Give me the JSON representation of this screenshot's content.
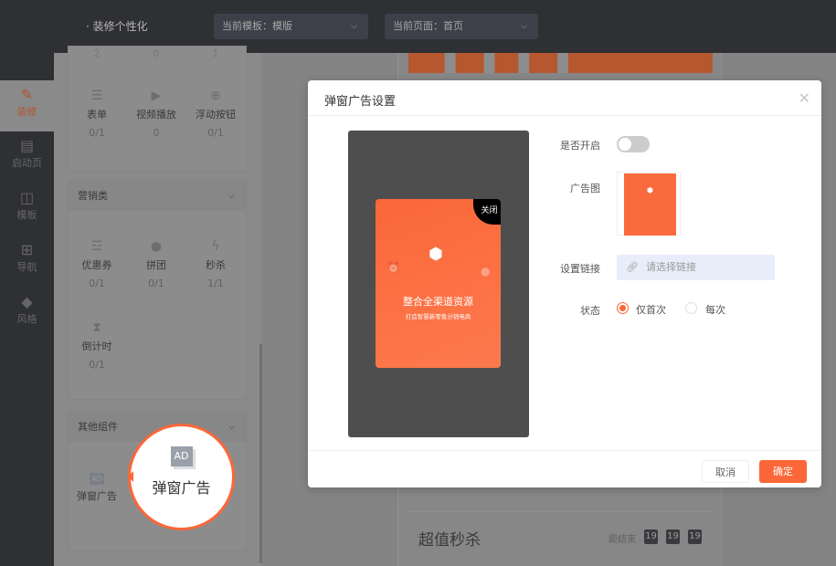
{
  "header": {
    "title": "· 装修个性化",
    "template_select": "当前模板：模版",
    "page_select": "当前页面：首页"
  },
  "nav": [
    {
      "label": "装修",
      "icon": "brush-icon"
    },
    {
      "label": "启动页",
      "icon": "page-icon"
    },
    {
      "label": "模板",
      "icon": "template-icon"
    },
    {
      "label": "导航",
      "icon": "grid-icon"
    },
    {
      "label": "风格",
      "icon": "paint-bucket-icon"
    }
  ],
  "panel": {
    "top_counts": [
      "2",
      "0",
      "1"
    ],
    "basic": [
      {
        "label": "表单",
        "count": "0/1"
      },
      {
        "label": "视频播放",
        "count": "0"
      },
      {
        "label": "浮动按钮",
        "count": "0/1"
      }
    ],
    "marketing": {
      "title": "营销类",
      "items": [
        {
          "label": "优惠券",
          "count": "0/1"
        },
        {
          "label": "拼团",
          "count": "0/1"
        },
        {
          "label": "秒杀",
          "count": "1/1"
        },
        {
          "label": "倒计时",
          "count": "0/1"
        }
      ]
    },
    "other": {
      "title": "其他组件",
      "items": [
        {
          "label": "弹窗广告",
          "icon_text": "AD"
        }
      ]
    }
  },
  "preview": {
    "seckill_title": "超值秒杀",
    "countdown_label": "距结束",
    "countdown": [
      "19",
      "19",
      "19"
    ]
  },
  "modal": {
    "title": "弹窗广告设置",
    "ad": {
      "close": "关闭",
      "headline": "整合全渠道资源",
      "sub": "打造智慧新零售分销电商"
    },
    "fields": {
      "enable_label": "是否开启",
      "enabled": false,
      "image_label": "广告图",
      "link_label": "设置链接",
      "link_placeholder": "请选择链接",
      "status_label": "状态",
      "status_options": [
        "仅首次",
        "每次"
      ],
      "status_selected": 0
    },
    "cancel": "取消",
    "confirm": "确定"
  },
  "callout": {
    "icon_text": "AD",
    "label": "弹窗广告"
  },
  "colors": {
    "accent": "#fb6738",
    "header": "#2f3034"
  }
}
